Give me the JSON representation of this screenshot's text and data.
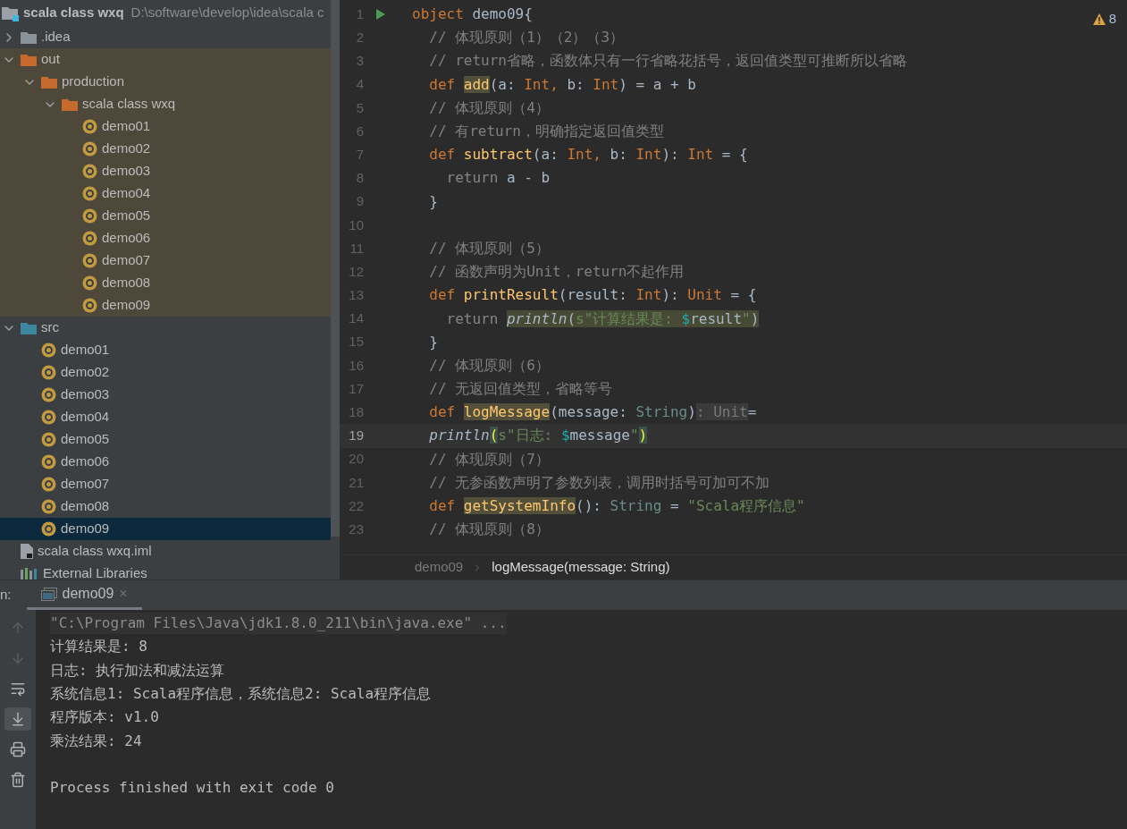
{
  "project": {
    "name": "scala class wxq",
    "path": "D:\\software\\develop\\idea\\scala c"
  },
  "tree": [
    {
      "label": ".idea",
      "kind": "folder",
      "color": "#8a9199",
      "expanded": false,
      "excluded": false,
      "selected": false
    },
    {
      "label": "out",
      "kind": "folder",
      "color": "#c66a2d",
      "expanded": true,
      "excluded": true,
      "selected": false,
      "children": [
        {
          "label": "production",
          "kind": "folder",
          "color": "#c66a2d",
          "expanded": true,
          "excluded": true,
          "selected": false,
          "children": [
            {
              "label": "scala class wxq",
              "kind": "folder",
              "color": "#c66a2d",
              "expanded": true,
              "excluded": true,
              "selected": false,
              "children": [
                {
                  "label": "demo01",
                  "kind": "object",
                  "excluded": true,
                  "selected": false
                },
                {
                  "label": "demo02",
                  "kind": "object",
                  "excluded": true,
                  "selected": false
                },
                {
                  "label": "demo03",
                  "kind": "object",
                  "excluded": true,
                  "selected": false
                },
                {
                  "label": "demo04",
                  "kind": "object",
                  "excluded": true,
                  "selected": false
                },
                {
                  "label": "demo05",
                  "kind": "object",
                  "excluded": true,
                  "selected": false
                },
                {
                  "label": "demo06",
                  "kind": "object",
                  "excluded": true,
                  "selected": false
                },
                {
                  "label": "demo07",
                  "kind": "object",
                  "excluded": true,
                  "selected": false
                },
                {
                  "label": "demo08",
                  "kind": "object",
                  "excluded": true,
                  "selected": false
                },
                {
                  "label": "demo09",
                  "kind": "object",
                  "excluded": true,
                  "selected": false
                }
              ]
            }
          ]
        }
      ]
    },
    {
      "label": "src",
      "kind": "folder",
      "color": "#3e86a0",
      "expanded": true,
      "excluded": false,
      "selected": false,
      "children": [
        {
          "label": "demo01",
          "kind": "object",
          "excluded": false,
          "selected": false
        },
        {
          "label": "demo02",
          "kind": "object",
          "excluded": false,
          "selected": false
        },
        {
          "label": "demo03",
          "kind": "object",
          "excluded": false,
          "selected": false
        },
        {
          "label": "demo04",
          "kind": "object",
          "excluded": false,
          "selected": false
        },
        {
          "label": "demo05",
          "kind": "object",
          "excluded": false,
          "selected": false
        },
        {
          "label": "demo06",
          "kind": "object",
          "excluded": false,
          "selected": false
        },
        {
          "label": "demo07",
          "kind": "object",
          "excluded": false,
          "selected": false
        },
        {
          "label": "demo08",
          "kind": "object",
          "excluded": false,
          "selected": false
        },
        {
          "label": "demo09",
          "kind": "object",
          "excluded": false,
          "selected": true
        }
      ]
    },
    {
      "label": "scala class wxq.iml",
      "kind": "iml",
      "excluded": false,
      "selected": false
    },
    {
      "label": "External Libraries",
      "kind": "libraries",
      "excluded": false,
      "selected": false
    }
  ],
  "editor": {
    "warnings": "8",
    "lines": [
      {
        "number": "1",
        "current": false,
        "run": true,
        "tokens": [
          {
            "kind": "kw",
            "text": "object"
          },
          {
            "kind": "plain",
            "text": " demo09{"
          }
        ]
      },
      {
        "number": "2",
        "current": false,
        "run": false,
        "tokens": [
          {
            "kind": "comment",
            "text": "  // 体现原则（1）（2）（3）"
          }
        ]
      },
      {
        "number": "3",
        "current": false,
        "run": false,
        "tokens": [
          {
            "kind": "comment",
            "text": "  // return省略，函数体只有一行省略花括号，返回值类型可推断所以省略"
          }
        ]
      },
      {
        "number": "4",
        "current": false,
        "run": false,
        "tokens": [
          {
            "kind": "kw",
            "text": "  def "
          },
          {
            "kind": "fn_m",
            "text": "add"
          },
          {
            "kind": "plain",
            "text": "(a: "
          },
          {
            "kind": "type",
            "text": "Int"
          },
          {
            "kind": "kw",
            "text": ", "
          },
          {
            "kind": "plain",
            "text": "b: "
          },
          {
            "kind": "type",
            "text": "Int"
          },
          {
            "kind": "plain",
            "text": ") = a + b"
          }
        ]
      },
      {
        "number": "5",
        "current": false,
        "run": false,
        "tokens": [
          {
            "kind": "comment",
            "text": "  // 体现原则（4）"
          }
        ]
      },
      {
        "number": "6",
        "current": false,
        "run": false,
        "tokens": [
          {
            "kind": "comment",
            "text": "  // 有return，明确指定返回值类型"
          }
        ]
      },
      {
        "number": "7",
        "current": false,
        "run": false,
        "tokens": [
          {
            "kind": "kw",
            "text": "  def "
          },
          {
            "kind": "fn",
            "text": "subtract"
          },
          {
            "kind": "plain",
            "text": "(a: "
          },
          {
            "kind": "type",
            "text": "Int"
          },
          {
            "kind": "kw",
            "text": ", "
          },
          {
            "kind": "plain",
            "text": "b: "
          },
          {
            "kind": "type",
            "text": "Int"
          },
          {
            "kind": "plain",
            "text": "): "
          },
          {
            "kind": "type",
            "text": "Int"
          },
          {
            "kind": "plain",
            "text": " = {"
          }
        ]
      },
      {
        "number": "8",
        "current": false,
        "run": false,
        "tokens": [
          {
            "kind": "dim",
            "text": "    return"
          },
          {
            "kind": "plain",
            "text": " a - b"
          }
        ]
      },
      {
        "number": "9",
        "current": false,
        "run": false,
        "tokens": [
          {
            "kind": "plain",
            "text": "  }"
          }
        ]
      },
      {
        "number": "10",
        "current": false,
        "run": false
      },
      {
        "number": "11",
        "current": false,
        "run": false,
        "tokens": [
          {
            "kind": "comment",
            "text": "  // 体现原则（5）"
          }
        ]
      },
      {
        "number": "12",
        "current": false,
        "run": false,
        "tokens": [
          {
            "kind": "comment",
            "text": "  // 函数声明为Unit，return不起作用"
          }
        ]
      },
      {
        "number": "13",
        "current": false,
        "run": false,
        "tokens": [
          {
            "kind": "kw",
            "text": "  def "
          },
          {
            "kind": "fn",
            "text": "printResult"
          },
          {
            "kind": "plain",
            "text": "(result: "
          },
          {
            "kind": "type",
            "text": "Int"
          },
          {
            "kind": "plain",
            "text": "): "
          },
          {
            "kind": "type",
            "text": "Unit"
          },
          {
            "kind": "plain",
            "text": " = {"
          }
        ]
      },
      {
        "number": "14",
        "current": false,
        "run": false,
        "tokens": [
          {
            "kind": "dim",
            "text": "    return "
          },
          {
            "kind": "italic_m",
            "text": "println"
          },
          {
            "kind": "plain_m",
            "text": "("
          },
          {
            "kind": "str_m",
            "text": "s\"计算结果是: "
          },
          {
            "kind": "interp_m",
            "text": "$"
          },
          {
            "kind": "plain_m",
            "text": "result"
          },
          {
            "kind": "str_m",
            "text": "\""
          },
          {
            "kind": "plain_m",
            "text": ")"
          }
        ]
      },
      {
        "number": "15",
        "current": false,
        "run": false,
        "tokens": [
          {
            "kind": "plain",
            "text": "  }"
          }
        ]
      },
      {
        "number": "16",
        "current": false,
        "run": false,
        "tokens": [
          {
            "kind": "comment",
            "text": "  // 体现原则（6）"
          }
        ]
      },
      {
        "number": "17",
        "current": false,
        "run": false,
        "tokens": [
          {
            "kind": "comment",
            "text": "  // 无返回值类型，省略等号"
          }
        ]
      },
      {
        "number": "18",
        "current": false,
        "run": false,
        "tokens": [
          {
            "kind": "kw",
            "text": "  def "
          },
          {
            "kind": "fn_m",
            "text": "logMessage"
          },
          {
            "kind": "plain",
            "text": "(message: "
          },
          {
            "kind": "type2",
            "text": "String"
          },
          {
            "kind": "plain",
            "text": ")"
          },
          {
            "kind": "hint",
            "text": ": Unit"
          },
          {
            "kind": "plain",
            "text": "="
          }
        ]
      },
      {
        "number": "19",
        "current": true,
        "run": false,
        "tokens": [
          {
            "kind": "italic",
            "text": "  println"
          },
          {
            "kind": "brace_m",
            "text": "("
          },
          {
            "kind": "str",
            "text": "s\"日志: "
          },
          {
            "kind": "interp",
            "text": "$"
          },
          {
            "kind": "plain",
            "text": "message"
          },
          {
            "kind": "str",
            "text": "\""
          },
          {
            "kind": "brace_m",
            "text": ")"
          }
        ]
      },
      {
        "number": "20",
        "current": false,
        "run": false,
        "tokens": [
          {
            "kind": "comment",
            "text": "  // 体现原则（7）"
          }
        ]
      },
      {
        "number": "21",
        "current": false,
        "run": false,
        "tokens": [
          {
            "kind": "comment",
            "text": "  // 无参函数声明了参数列表，调用时括号可加可不加"
          }
        ]
      },
      {
        "number": "22",
        "current": false,
        "run": false,
        "tokens": [
          {
            "kind": "kw",
            "text": "  def "
          },
          {
            "kind": "fn_m",
            "text": "getSystemInfo"
          },
          {
            "kind": "plain",
            "text": "(): "
          },
          {
            "kind": "type2",
            "text": "String"
          },
          {
            "kind": "plain",
            "text": " = "
          },
          {
            "kind": "str",
            "text": "\"Scala程序信息\""
          }
        ]
      },
      {
        "number": "23",
        "current": false,
        "run": false,
        "tokens": [
          {
            "kind": "comment",
            "text": "  // 体现原则（8）"
          }
        ]
      }
    ],
    "breadcrumb": [
      "demo09",
      "logMessage(message: String)"
    ]
  },
  "run_panel": {
    "label": "n:",
    "tab": {
      "label": "demo09",
      "close": "×"
    },
    "console": [
      {
        "kind": "command",
        "text": "\"C:\\Program Files\\Java\\jdk1.8.0_211\\bin\\java.exe\" ..."
      },
      {
        "kind": "output",
        "text": "计算结果是: 8"
      },
      {
        "kind": "output",
        "text": "日志: 执行加法和减法运算"
      },
      {
        "kind": "output",
        "text": "系统信息1: Scala程序信息，系统信息2: Scala程序信息"
      },
      {
        "kind": "output",
        "text": "程序版本: v1.0"
      },
      {
        "kind": "output",
        "text": "乘法结果: 24"
      },
      {
        "kind": "blank"
      },
      {
        "kind": "output",
        "text": "Process finished with exit code 0"
      }
    ],
    "tools": [
      {
        "kind": "up",
        "disabled": true,
        "selected": false
      },
      {
        "kind": "down",
        "disabled": true,
        "selected": false
      },
      {
        "kind": "wrap",
        "disabled": false,
        "selected": false
      },
      {
        "kind": "scroll",
        "disabled": false,
        "selected": true
      },
      {
        "kind": "print",
        "disabled": false,
        "selected": false
      },
      {
        "kind": "trash",
        "disabled": false,
        "selected": false
      }
    ]
  }
}
